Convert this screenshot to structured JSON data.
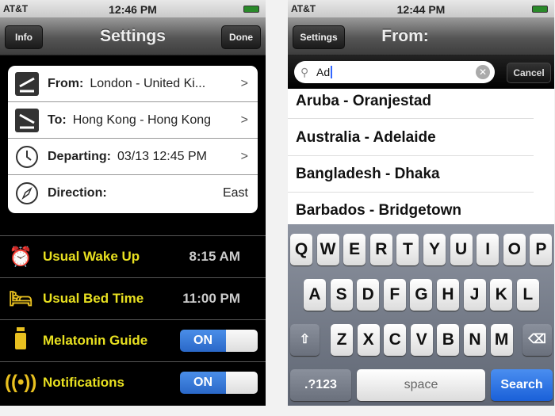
{
  "left": {
    "status": {
      "carrier": "AT&T",
      "time": "12:46 PM"
    },
    "nav": {
      "title": "Settings",
      "left_button": "Info",
      "right_button": "Done"
    },
    "trip": [
      {
        "label": "From:",
        "value": "London - United Ki...",
        "icon": "takeoff-icon",
        "chevron": true
      },
      {
        "label": "To:",
        "value": "Hong Kong - Hong Kong",
        "icon": "landing-icon",
        "chevron": true
      },
      {
        "label": "Departing:",
        "value": "03/13 12:45 PM",
        "icon": "clock-icon",
        "chevron": true
      },
      {
        "label": "Direction:",
        "value": "East",
        "icon": "compass-icon",
        "chevron": false
      }
    ],
    "settings": [
      {
        "label": "Usual Wake Up",
        "value": "8:15 AM",
        "icon": "alarm-clock-icon"
      },
      {
        "label": "Usual Bed Time",
        "value": "11:00 PM",
        "icon": "bed-icon"
      },
      {
        "label": "Melatonin Guide",
        "toggle": "ON",
        "icon": "pill-bottle-icon"
      },
      {
        "label": "Notifications",
        "toggle": "ON",
        "icon": "broadcast-icon"
      }
    ],
    "accent": "#e8e020"
  },
  "right": {
    "status": {
      "carrier": "AT&T",
      "time": "12:44 PM"
    },
    "nav": {
      "title": "From:",
      "back_button": "Settings"
    },
    "search": {
      "value": "Ad",
      "cancel": "Cancel"
    },
    "results": [
      "Aruba - Oranjestad",
      "Australia - Adelaide",
      "Bangladesh - Dhaka",
      "Barbados - Bridgetown"
    ],
    "keyboard": {
      "row1": [
        "Q",
        "W",
        "E",
        "R",
        "T",
        "Y",
        "U",
        "I",
        "O",
        "P"
      ],
      "row2": [
        "A",
        "S",
        "D",
        "F",
        "G",
        "H",
        "J",
        "K",
        "L"
      ],
      "row3": [
        "Z",
        "X",
        "C",
        "V",
        "B",
        "N",
        "M"
      ],
      "numbers": ".?123",
      "space": "space",
      "search": "Search"
    }
  }
}
